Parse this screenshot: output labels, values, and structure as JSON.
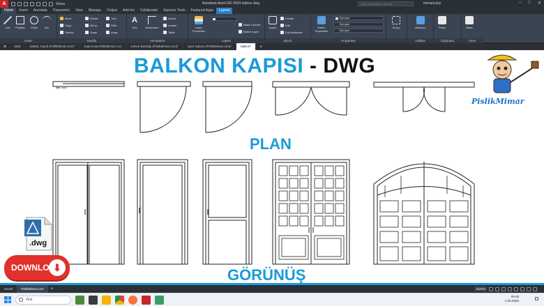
{
  "titlebar": {
    "logo_letter": "A",
    "share_label": "Share",
    "app_title": "Autodesk AutoCAD 2024    balkon.dwg",
    "search_placeholder": "Type a keyword or phrase",
    "user_name": "mimarlucky",
    "window_controls": [
      "–",
      "□",
      "✕"
    ]
  },
  "ribbon_tabs": [
    "Home",
    "Insert",
    "Annotate",
    "Parametric",
    "View",
    "Manage",
    "Output",
    "Add-ins",
    "Collaborate",
    "Express Tools",
    "Featured Apps",
    "Layout"
  ],
  "ribbon": {
    "draw": {
      "label": "Draw",
      "tools": [
        "Line",
        "Polyline",
        "Circle",
        "Arc"
      ]
    },
    "modify": {
      "label": "Modify",
      "tools": [
        "Move",
        "Rotate",
        "Trim",
        "Copy",
        "Mirror",
        "Fillet",
        "Stretch",
        "Scale",
        "Array"
      ]
    },
    "annotation": {
      "label": "Annotation",
      "tools": [
        "Text",
        "Dimension",
        "Linear",
        "Leader",
        "Table"
      ]
    },
    "layers": {
      "label": "Layers",
      "tools": [
        "Layer Properties",
        "Make Current",
        "Match Layer"
      ]
    },
    "block": {
      "label": "Block",
      "tools": [
        "Insert",
        "Create",
        "Edit",
        "Edit Attributes"
      ]
    },
    "properties": {
      "label": "Properties",
      "tools": [
        "Match Properties"
      ],
      "dropdowns": [
        "ByLayer",
        "ByLayer",
        "ByLayer"
      ]
    },
    "groups": {
      "label": "",
      "tools": [
        "Group"
      ]
    },
    "utilities": {
      "label": "Utilities",
      "tools": [
        "Measure"
      ]
    },
    "clipboard": {
      "label": "Clipboard",
      "tools": [
        "Paste"
      ]
    },
    "view": {
      "label": "View",
      "tools": [
        "Base"
      ]
    }
  },
  "file_tabs": [
    "Start",
    "Sebek, Kayık (PislikMimar.com)*",
    "Kapı-Kota-PislikMimar.com",
    "Kahve Bardağı (PislikMimar.com)*",
    "Spor Salonu (PislikMimar.com)*",
    "balkon*"
  ],
  "drawing": {
    "title_blue": "BALKON KAPISI",
    "title_dark": " - DWG",
    "plan_label": "PLAN",
    "elevation_label": "GÖRÜNÜŞ",
    "mascot_brand": "PislikMimar",
    "dwg_icon_label": ".dwg",
    "download_label": "DOWNLOAD"
  },
  "status_bar": {
    "layout_tabs": [
      "Model",
      "PislikMimar.com"
    ],
    "paper_label": "PAPER"
  },
  "taskbar": {
    "search_placeholder": "Ara",
    "time": "09:48",
    "date": "2.05.2026"
  },
  "colors": {
    "accent_blue": "#1a9bd7",
    "download_red": "#e0312a",
    "autocad_red": "#c8242b",
    "ribbon_dark": "#3b4453"
  }
}
